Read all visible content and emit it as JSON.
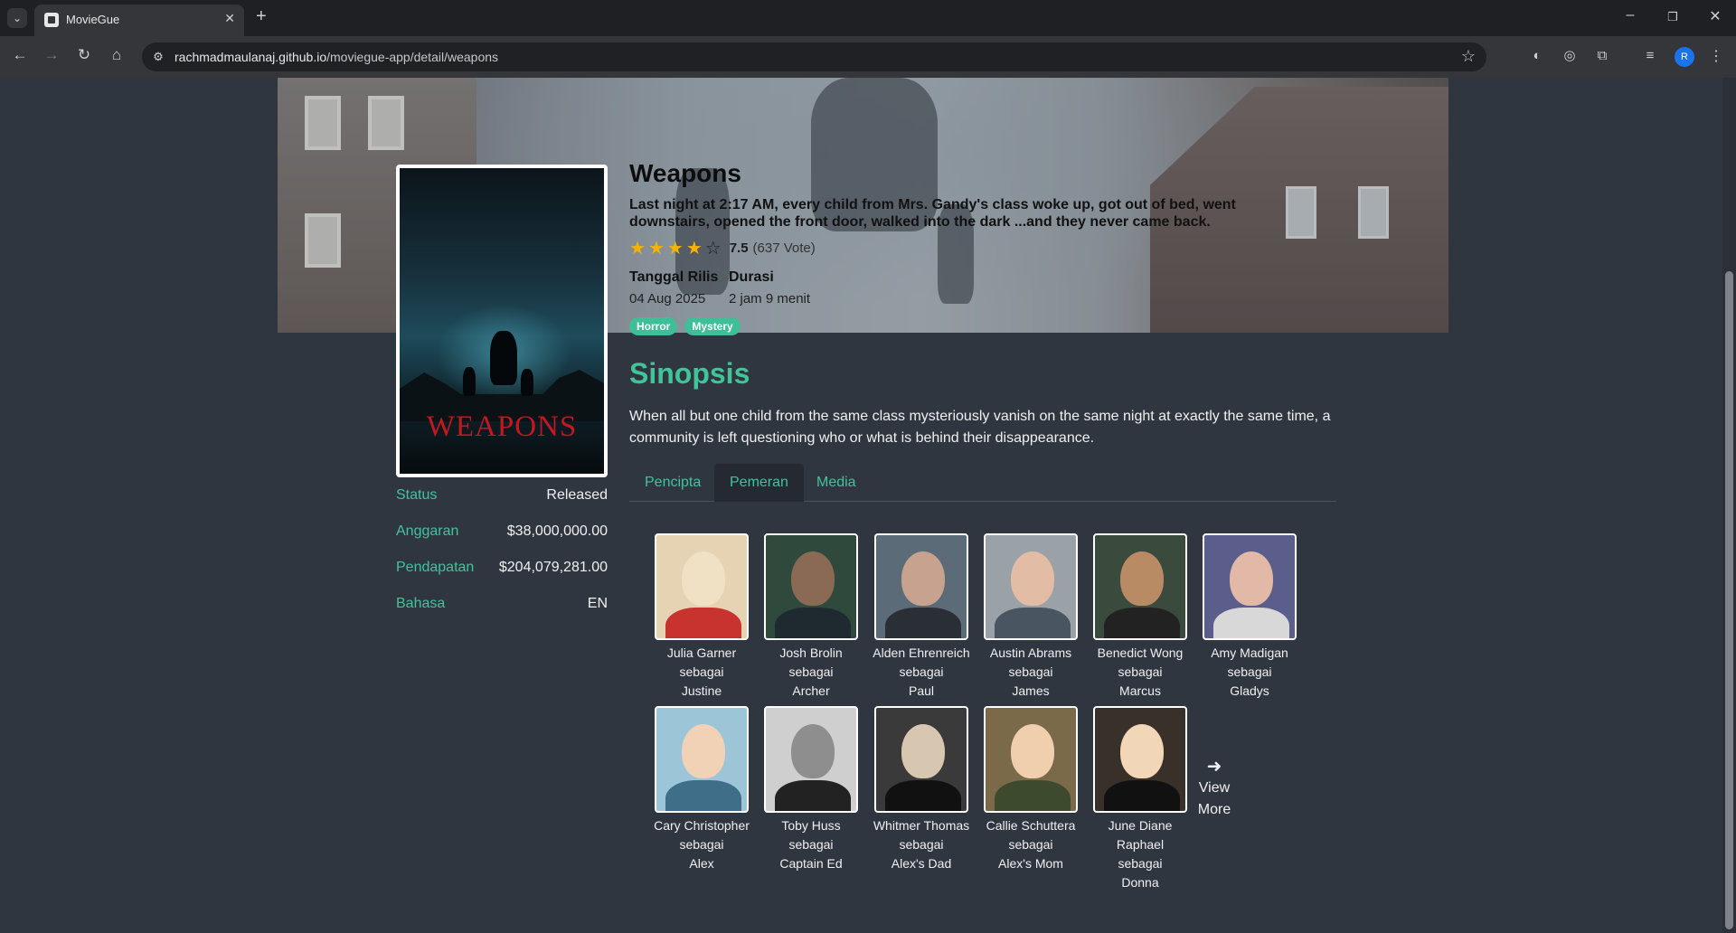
{
  "browser": {
    "tab_title": "MovieGue",
    "url_host": "rachmadmaulanaj.github.io",
    "url_path": "/moviegue-app/detail/weapons",
    "profile_initial": "R"
  },
  "movie": {
    "poster_text": "WEAPONS",
    "title": "Weapons",
    "tagline": "Last night at 2:17 AM, every child from Mrs. Gandy's class woke up, got out of bed, went downstairs, opened the front door, walked into the dark ...and they never came back.",
    "rating_value": "7.5",
    "rating_votes": "(637 Vote)",
    "stars_filled": 4,
    "stars_total": 5,
    "release_label": "Tanggal Rilis",
    "release_value": "04 Aug 2025",
    "duration_label": "Durasi",
    "duration_value": "2 jam 9 menit",
    "genres": [
      "Horror",
      "Mystery"
    ],
    "sinopsis_title": "Sinopsis",
    "sinopsis": "When all but one child from the same class mysteriously vanish on the same night at exactly the same time, a community is left questioning who or what is behind their disappearance."
  },
  "info": [
    {
      "label": "Status",
      "value": "Released"
    },
    {
      "label": "Anggaran",
      "value": "$38,000,000.00"
    },
    {
      "label": "Pendapatan",
      "value": "$204,079,281.00"
    },
    {
      "label": "Bahasa",
      "value": "EN"
    }
  ],
  "tabs": [
    {
      "label": "Pencipta",
      "active": false
    },
    {
      "label": "Pemeran",
      "active": true
    },
    {
      "label": "Media",
      "active": false
    }
  ],
  "cast": [
    {
      "name": "Julia Garner",
      "as": "sebagai",
      "role": "Justine"
    },
    {
      "name": "Josh Brolin",
      "as": "sebagai",
      "role": "Archer"
    },
    {
      "name": "Alden Ehrenreich",
      "as": "sebagai",
      "role": "Paul"
    },
    {
      "name": "Austin Abrams",
      "as": "sebagai",
      "role": "James"
    },
    {
      "name": "Benedict Wong",
      "as": "sebagai",
      "role": "Marcus"
    },
    {
      "name": "Amy Madigan",
      "as": "sebagai",
      "role": "Gladys"
    },
    {
      "name": "Cary Christopher",
      "as": "sebagai",
      "role": "Alex"
    },
    {
      "name": "Toby Huss",
      "as": "sebagai",
      "role": "Captain Ed"
    },
    {
      "name": "Whitmer Thomas",
      "as": "sebagai",
      "role": "Alex's Dad"
    },
    {
      "name": "Callie Schuttera",
      "as": "sebagai",
      "role": "Alex's Mom"
    },
    {
      "name": "June Diane Raphael",
      "as": "sebagai",
      "role": "Donna"
    }
  ],
  "view_more": "View More",
  "colors": {
    "accent": "#42c39a",
    "genre_badge": "#3ebf97",
    "page_bg": "#2f3640",
    "star": "#f5b301"
  }
}
